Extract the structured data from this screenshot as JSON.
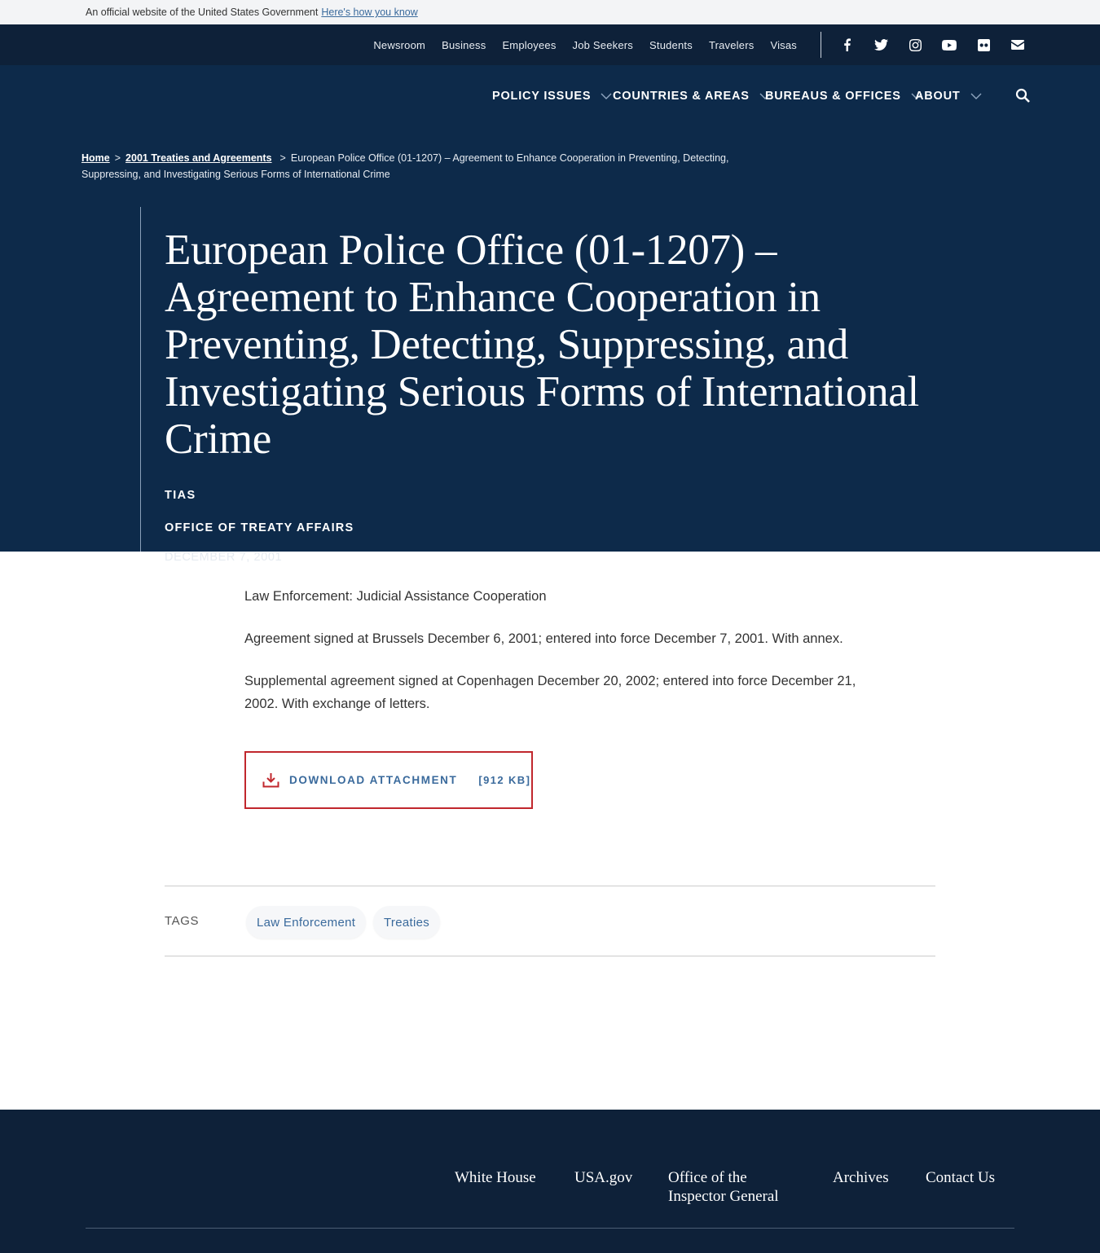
{
  "banner": {
    "text": "An official website of the United States Government",
    "link": "Here's how you know"
  },
  "utility": {
    "links": [
      "Newsroom",
      "Business",
      "Employees",
      "Job Seekers",
      "Students",
      "Travelers",
      "Visas"
    ],
    "social_icons": [
      "facebook-icon",
      "twitter-icon",
      "instagram-icon",
      "youtube-icon",
      "flickr-icon",
      "email-icon"
    ]
  },
  "nav": {
    "items": [
      "POLICY ISSUES",
      "COUNTRIES & AREAS",
      "BUREAUS & OFFICES",
      "ABOUT"
    ],
    "search_icon": "search-icon"
  },
  "breadcrumb": {
    "home": "Home",
    "parent": "2001 Treaties and Agreements",
    "separator": ">",
    "current": "European Police Office (01-1207) – Agreement to Enhance Cooperation in Preventing, Detecting, Suppressing, and Investigating Serious Forms of International Crime"
  },
  "article": {
    "title": "European Police Office (01-1207) – Agreement to Enhance Cooperation in Preventing, Detecting, Suppressing, and Investigating Serious Forms of International Crime",
    "type": "TIAS",
    "office": "OFFICE OF TREATY AFFAIRS",
    "date": "DECEMBER 7, 2001",
    "paragraphs": [
      "Law Enforcement: Judicial Assistance Cooperation",
      "Agreement signed at Brussels December 6, 2001; entered into force December 7, 2001. With annex.",
      "Supplemental agreement signed at Copenhagen December 20, 2002; entered into force December 21, 2002. With exchange of letters."
    ]
  },
  "download": {
    "label": "DOWNLOAD ATTACHMENT",
    "size": "[912 KB]",
    "icon": "download-icon",
    "accent": "#c1272d"
  },
  "tags": {
    "label": "TAGS",
    "items": [
      "Law Enforcement",
      "Treaties"
    ]
  },
  "footer": {
    "links": [
      "White House",
      "USA.gov",
      "Office of the Inspector General",
      "Archives",
      "Contact Us"
    ]
  },
  "colors": {
    "hero": "#0d2a4a",
    "utility": "#0e2139",
    "link": "#3a6a9c"
  }
}
